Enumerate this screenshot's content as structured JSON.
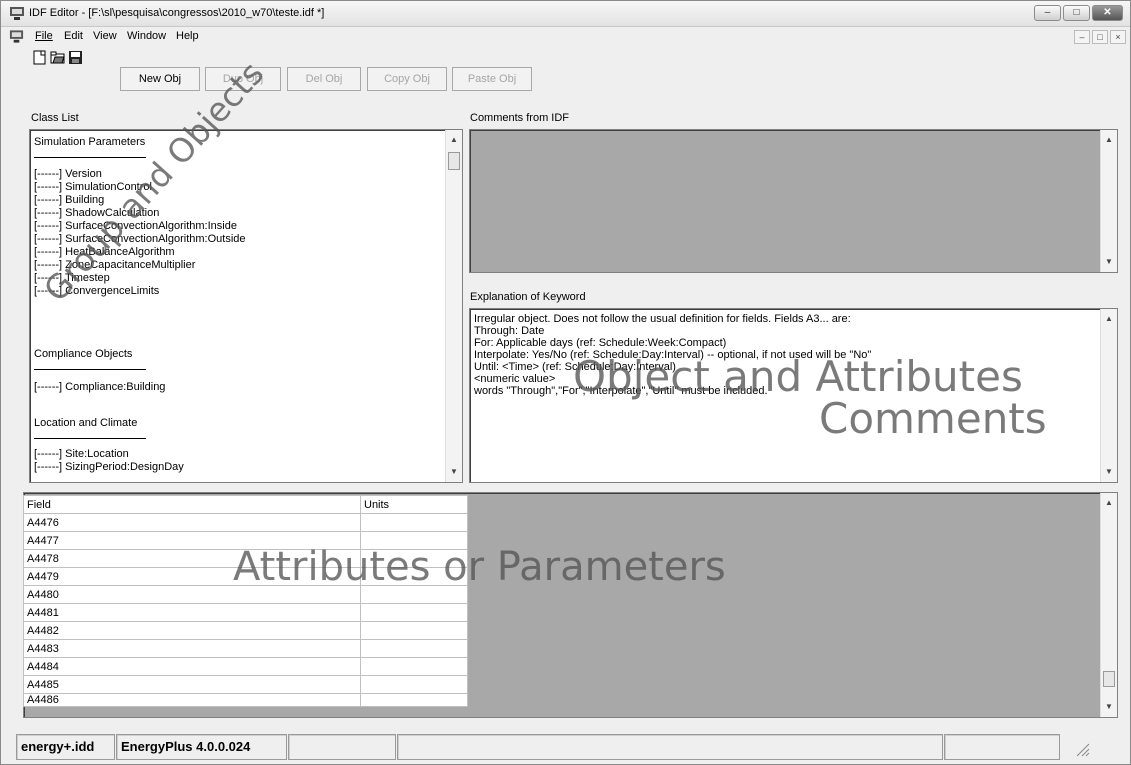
{
  "window": {
    "title": "IDF Editor - [F:\\sl\\pesquisa\\congressos\\2010_w70\\teste.idf *]",
    "controls": [
      "minimize",
      "maximize",
      "close"
    ]
  },
  "menu": {
    "items": [
      "File",
      "Edit",
      "View",
      "Window",
      "Help"
    ]
  },
  "toolbar": {
    "buttons": [
      {
        "label": "New Obj",
        "enabled": true
      },
      {
        "label": "Dup Obj",
        "enabled": false
      },
      {
        "label": "Del Obj",
        "enabled": false
      },
      {
        "label": "Copy Obj",
        "enabled": false
      },
      {
        "label": "Paste Obj",
        "enabled": false
      }
    ]
  },
  "class_list": {
    "label": "Class List",
    "items": [
      "Simulation Parameters",
      "[------] Version",
      "[------] SimulationControl",
      "[------] Building",
      "[------] ShadowCalculation",
      "[------] SurfaceConvectionAlgorithm:Inside",
      "[------] SurfaceConvectionAlgorithm:Outside",
      "[------] HeatBalanceAlgorithm",
      "[------] ZoneCapacitanceMultiplier",
      "[------] Timestep",
      "[------] ConvergenceLimits",
      "Compliance Objects",
      "[------] Compliance:Building",
      "Location and Climate",
      "[------] Site:Location",
      "[------] SizingPeriod:DesignDay"
    ]
  },
  "comments": {
    "label": "Comments from IDF"
  },
  "explanation": {
    "label": "Explanation of Keyword",
    "lines": [
      "Irregular object.  Does not follow the usual definition for fields.  Fields A3... are:",
      "Through: Date",
      "For: Applicable days (ref: Schedule:Week:Compact)",
      "Interpolate: Yes/No (ref: Schedule:Day:Interval) -- optional, if not used will be \"No\"",
      "Until: <Time> (ref: Schedule:Day:Interval)",
      "<numeric value>",
      "words \"Through\",\"For\",\"Interpolate\",\"Until\" must be included."
    ]
  },
  "grid": {
    "columns": [
      "Field",
      "Units"
    ],
    "rows": [
      "A4476",
      "A4477",
      "A4478",
      "A4479",
      "A4480",
      "A4481",
      "A4482",
      "A4483",
      "A4484",
      "A4485",
      "A4486"
    ]
  },
  "annotations": {
    "group": "Group and Objects",
    "object_line1": "Object and Attributes",
    "object_line2": "Comments",
    "attributes": "Attributes or Parameters"
  },
  "status": {
    "idd": "energy+.idd",
    "version": "EnergyPlus 4.0.0.024"
  }
}
